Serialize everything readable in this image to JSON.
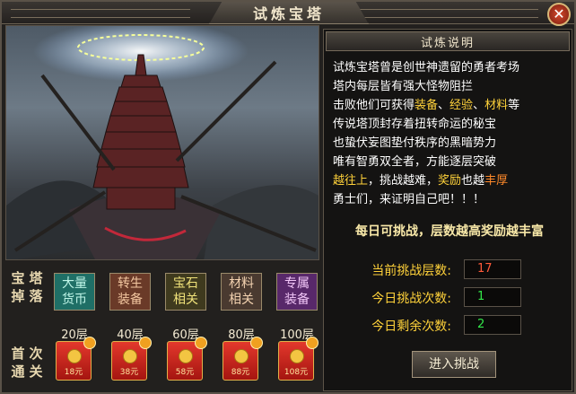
{
  "window": {
    "title": "试炼宝塔",
    "close_label": "✕"
  },
  "recommend": {
    "label": "宝塔掉落",
    "buttons": [
      {
        "line1": "大量",
        "line2": "货币",
        "bg": "#1f6f66",
        "fg": "#bff6e8"
      },
      {
        "line1": "转生",
        "line2": "装备",
        "bg": "#6a3a28",
        "fg": "#f3c7a0"
      },
      {
        "line1": "宝石",
        "line2": "相关",
        "bg": "#3f3a1e",
        "fg": "#f0e27a"
      },
      {
        "line1": "材料",
        "line2": "相关",
        "bg": "#4a3a30",
        "fg": "#f3d2b0"
      },
      {
        "line1": "专属",
        "line2": "装备",
        "bg": "#58286a",
        "fg": "#f2c6f8"
      }
    ]
  },
  "first_clear": {
    "label": "首次通关",
    "rewards": [
      {
        "floor": "20层",
        "amount": "18元"
      },
      {
        "floor": "40层",
        "amount": "38元"
      },
      {
        "floor": "60层",
        "amount": "58元"
      },
      {
        "floor": "80层",
        "amount": "88元"
      },
      {
        "floor": "100层",
        "amount": "108元"
      }
    ]
  },
  "panel": {
    "title": "试炼说明",
    "desc": {
      "l1": "试炼宝塔曾是创世神遗留的勇者考场",
      "l2": "塔内每层皆有强大怪物阻拦",
      "l3a": "击败他们可获得",
      "l3b": "装备",
      "l3c": "、",
      "l3d": "经验",
      "l3e": "、",
      "l3f": "材料",
      "l3g": "等",
      "l4": "传说塔顶封存着扭转命运的秘宝",
      "l5": "也蛰伏妄图垫付秩序的黑暗势力",
      "l6": "唯有智勇双全者，方能逐层突破",
      "l7a": "越往上",
      "l7b": "，挑战越难，",
      "l7c": "奖励",
      "l7d": "也越",
      "l7e": "丰厚",
      "l8": "勇士们，来证明自己吧！！！"
    },
    "slogan": "每日可挑战，层数越高奖励越丰富",
    "stats": [
      {
        "label": "当前挑战层数:",
        "value": "17"
      },
      {
        "label": "今日挑战次数:",
        "value": "1"
      },
      {
        "label": "今日剩余次数:",
        "value": "2"
      }
    ],
    "enter_label": "进入挑战"
  }
}
